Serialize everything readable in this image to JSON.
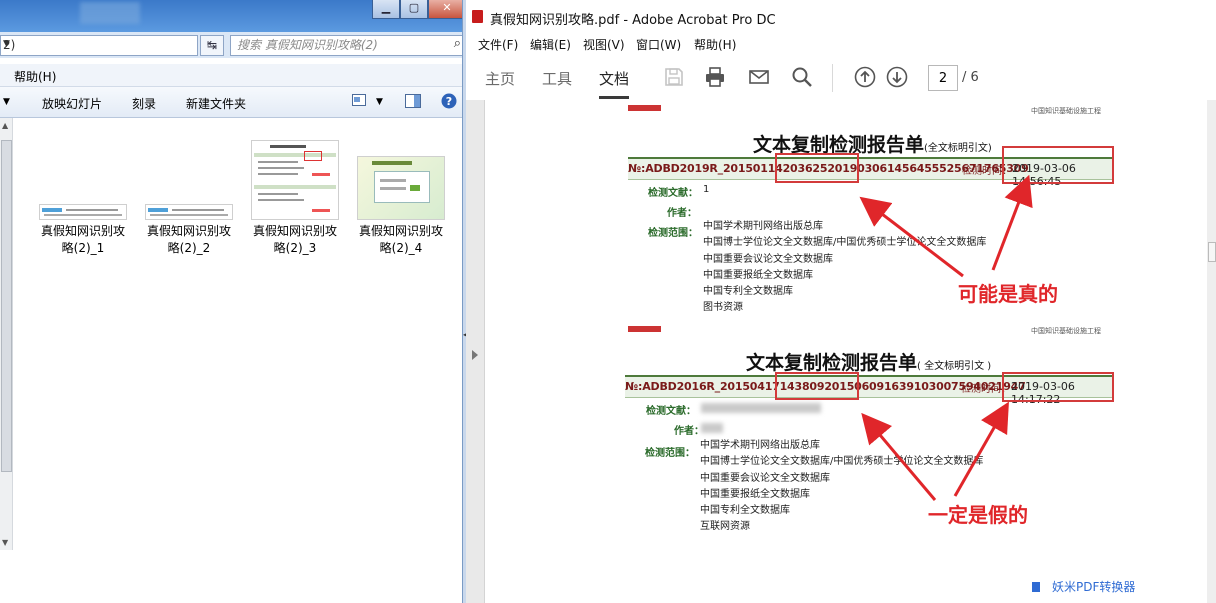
{
  "explorer": {
    "address_text": "2)",
    "search_placeholder": "搜索 真假知网识别攻略(2)",
    "menu_help": "帮助(H)",
    "toolbar": {
      "slideshow": "放映幻灯片",
      "burn": "刻录",
      "new_folder": "新建文件夹"
    },
    "files": [
      {
        "line1": "真假知网识别攻",
        "line2": "略(2)_1"
      },
      {
        "line1": "真假知网识别攻",
        "line2": "略(2)_2"
      },
      {
        "line1": "真假知网识别攻",
        "line2": "略(2)_3"
      },
      {
        "line1": "真假知网识别攻",
        "line2": "略(2)_4"
      }
    ]
  },
  "acrobat": {
    "title": "真假知网识别攻略.pdf - Adobe Acrobat Pro DC",
    "menu": [
      "文件(F)",
      "编辑(E)",
      "视图(V)",
      "窗口(W)",
      "帮助(H)"
    ],
    "tabs": {
      "home": "主页",
      "tools": "工具",
      "document": "文档"
    },
    "page_current": "2",
    "page_total": "/ 6",
    "watermark": "妖米PDF转换器"
  },
  "report1": {
    "header_small": "中国知识基础设施工程",
    "title": "文本复制检测报告单",
    "title_note": "(全文标明引文)",
    "id": "№:ADBD2019R_20150114203625201903061456455525671765309",
    "time_label": "检测时间：",
    "time": "2019-03-06 14:56:45",
    "doc_label": "检测文献：",
    "doc_value": "1",
    "author_label": "作者：",
    "scope_label": "检测范围：",
    "scope": [
      "中国学术期刊网络出版总库",
      "中国博士学位论文全文数据库/中国优秀硕士学位论文全文数据库",
      "中国重要会议论文全文数据库",
      "中国重要报纸全文数据库",
      "中国专利全文数据库",
      "图书资源"
    ],
    "verdict": "可能是真的"
  },
  "report2": {
    "header_small": "中国知识基础设施工程",
    "title": "文本复制检测报告单",
    "title_note": "( 全文标明引文 )",
    "id": "№:ADBD2016R_20150417143809201506091639103007594021947",
    "time_label": "检测时间：",
    "time": "2019-03-06 14:17:22",
    "doc_label": "检测文献：",
    "author_label": "作者：",
    "scope_label": "检测范围：",
    "scope": [
      "中国学术期刊网络出版总库",
      "中国博士学位论文全文数据库/中国优秀硕士学位论文全文数据库",
      "中国重要会议论文全文数据库",
      "中国重要报纸全文数据库",
      "中国专利全文数据库",
      "互联网资源"
    ],
    "verdict": "一定是假的"
  }
}
